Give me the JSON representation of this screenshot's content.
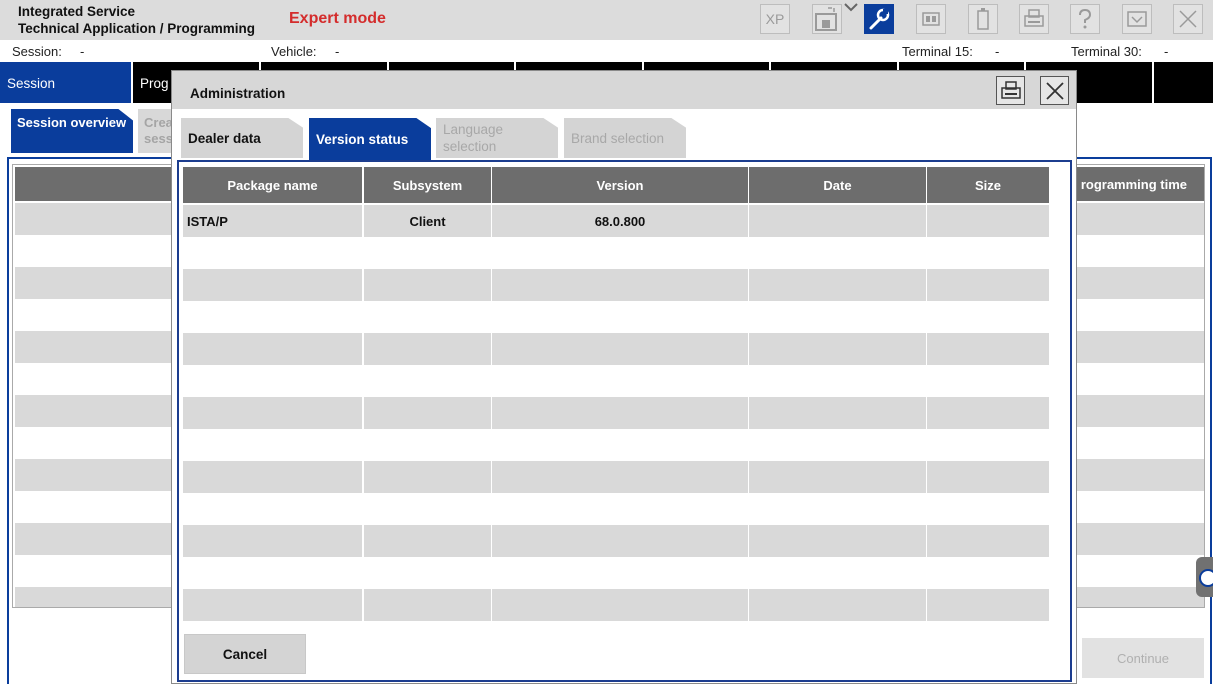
{
  "app": {
    "title_line1": "Integrated Service",
    "title_line2": "Technical Application / Programming",
    "mode": "Expert mode"
  },
  "toolbar": {
    "xp_label": "XP",
    "icons": [
      "image-icon",
      "wrench-icon",
      "grid-icon",
      "battery-icon",
      "print-icon",
      "help-icon",
      "hide-icon",
      "close-icon"
    ]
  },
  "status": {
    "session_label": "Session:",
    "session_value": "-",
    "vehicle_label": "Vehicle:",
    "vehicle_value": "-",
    "terminal15_label": "Terminal 15:",
    "terminal15_value": "-",
    "terminal30_label": "Terminal 30:",
    "terminal30_value": "-"
  },
  "mainnav": {
    "tabs": [
      "Session",
      "Prog"
    ]
  },
  "subnav": {
    "session_overview": "Session overview",
    "create_session": "Crea sess"
  },
  "background": {
    "last_column_header": "rogramming time",
    "continue_label": "Continue"
  },
  "dialog": {
    "title": "Administration",
    "tabs": {
      "dealer_data": "Dealer data",
      "version_status": "Version status",
      "language_selection": "Language selection",
      "brand_selection": "Brand selection"
    },
    "table": {
      "columns": [
        "Package name",
        "Subsystem",
        "Version",
        "Date",
        "Size"
      ],
      "rows": [
        [
          "ISTA/P",
          "Client",
          "68.0.800",
          "",
          ""
        ]
      ]
    },
    "cancel_label": "Cancel"
  }
}
